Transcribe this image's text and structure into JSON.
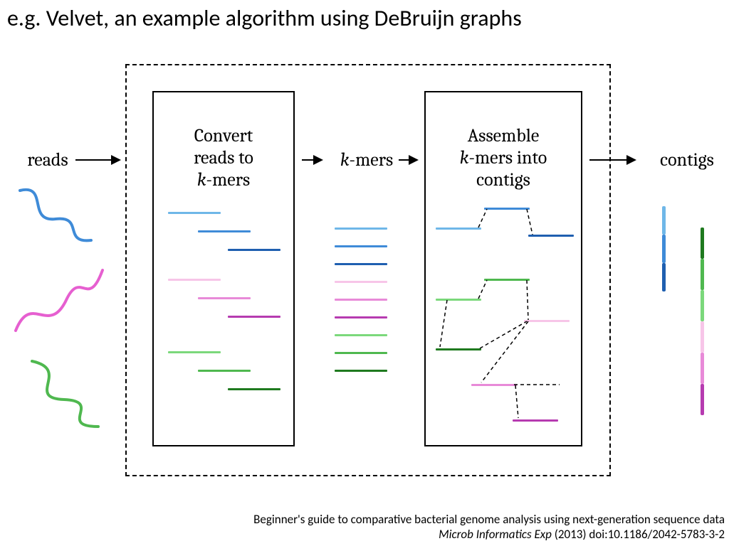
{
  "title": "e.g. Velvet, an example algorithm using DeBruijn graphs",
  "labels": {
    "reads": "reads",
    "kmers_pre": "k",
    "kmers_post": "-mers",
    "contigs": "contigs",
    "box1_line1": "Convert",
    "box1_line2": "reads to",
    "box1_line3_pre": "k",
    "box1_line3_post": "-mers",
    "box2_line1": "Assemble",
    "box2_line2_pre": "k",
    "box2_line2_post": "-mers into",
    "box2_line3": "contigs"
  },
  "citation": {
    "line1": "Beginner's guide to comparative bacterial genome analysis using next-generation sequence data",
    "journal": "Microb Informatics Exp",
    "rest": " (2013) doi:10.1186/2042-5783-3-2"
  },
  "colors": {
    "blue_light": "#6fb7e8",
    "blue_mid": "#3f8bd8",
    "blue_dark": "#1f5fb0",
    "pink_light": "#f7c5e8",
    "pink_mid": "#e88ad8",
    "pink_dark": "#b63bb0",
    "green_light": "#7bd87b",
    "green_mid": "#4fb84f",
    "green_dark": "#1f7a1f"
  }
}
